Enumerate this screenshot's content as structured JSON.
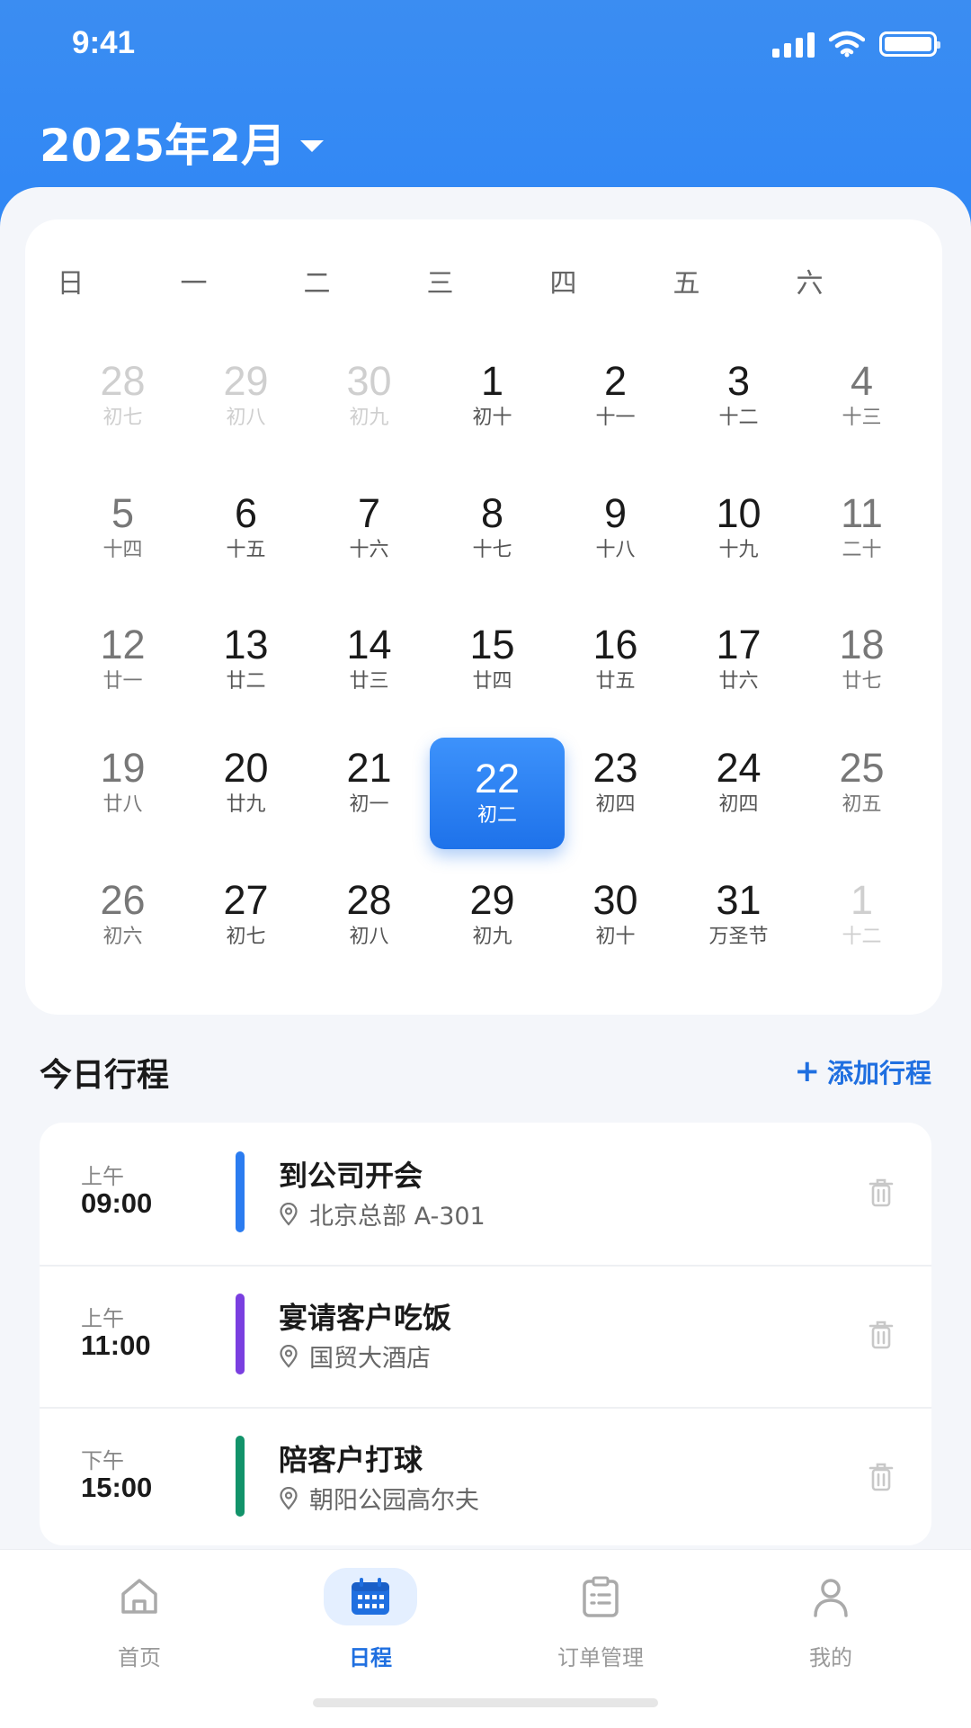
{
  "status_bar": {
    "time": "9:41"
  },
  "header": {
    "month_title": "2025年2月"
  },
  "calendar": {
    "weekdays": [
      "日",
      "一",
      "二",
      "三",
      "四",
      "五",
      "六"
    ],
    "weeks": [
      [
        {
          "n": "28",
          "s": "初七",
          "t": "other"
        },
        {
          "n": "29",
          "s": "初八",
          "t": "other"
        },
        {
          "n": "30",
          "s": "初九",
          "t": "other"
        },
        {
          "n": "1",
          "s": "初十",
          "t": "normal"
        },
        {
          "n": "2",
          "s": "十一",
          "t": "normal"
        },
        {
          "n": "3",
          "s": "十二",
          "t": "normal"
        },
        {
          "n": "4",
          "s": "十三",
          "t": "weekend"
        }
      ],
      [
        {
          "n": "5",
          "s": "十四",
          "t": "weekend"
        },
        {
          "n": "6",
          "s": "十五",
          "t": "normal"
        },
        {
          "n": "7",
          "s": "十六",
          "t": "normal"
        },
        {
          "n": "8",
          "s": "十七",
          "t": "normal"
        },
        {
          "n": "9",
          "s": "十八",
          "t": "normal"
        },
        {
          "n": "10",
          "s": "十九",
          "t": "normal"
        },
        {
          "n": "11",
          "s": "二十",
          "t": "weekend"
        }
      ],
      [
        {
          "n": "12",
          "s": "廿一",
          "t": "weekend"
        },
        {
          "n": "13",
          "s": "廿二",
          "t": "normal"
        },
        {
          "n": "14",
          "s": "廿三",
          "t": "normal"
        },
        {
          "n": "15",
          "s": "廿四",
          "t": "normal"
        },
        {
          "n": "16",
          "s": "廿五",
          "t": "normal"
        },
        {
          "n": "17",
          "s": "廿六",
          "t": "normal"
        },
        {
          "n": "18",
          "s": "廿七",
          "t": "weekend"
        }
      ],
      [
        {
          "n": "19",
          "s": "廿八",
          "t": "weekend"
        },
        {
          "n": "20",
          "s": "廿九",
          "t": "normal"
        },
        {
          "n": "21",
          "s": "初一",
          "t": "normal"
        },
        {
          "n": "22",
          "s": "初二",
          "t": "selected"
        },
        {
          "n": "23",
          "s": "初四",
          "t": "normal"
        },
        {
          "n": "24",
          "s": "初四",
          "t": "normal"
        },
        {
          "n": "25",
          "s": "初五",
          "t": "weekend"
        }
      ],
      [
        {
          "n": "26",
          "s": "初六",
          "t": "weekend"
        },
        {
          "n": "27",
          "s": "初七",
          "t": "normal"
        },
        {
          "n": "28",
          "s": "初八",
          "t": "normal"
        },
        {
          "n": "29",
          "s": "初九",
          "t": "normal"
        },
        {
          "n": "30",
          "s": "初十",
          "t": "normal"
        },
        {
          "n": "31",
          "s": "万圣节",
          "t": "normal"
        },
        {
          "n": "1",
          "s": "十二",
          "t": "other"
        }
      ]
    ]
  },
  "schedule": {
    "title": "今日行程",
    "add_label": "添加行程",
    "add_plus": "+",
    "events": [
      {
        "period": "上午",
        "time": "09:00",
        "title": "到公司开会",
        "location": "北京总部 A-301",
        "color": "#2b7cf0"
      },
      {
        "period": "上午",
        "time": "11:00",
        "title": "宴请客户吃饭",
        "location": "国贸大酒店",
        "color": "#7a3fe0"
      },
      {
        "period": "下午",
        "time": "15:00",
        "title": "陪客户打球",
        "location": "朝阳公园高尔夫",
        "color": "#12936a"
      }
    ]
  },
  "tabbar": {
    "items": [
      {
        "label": "首页",
        "icon": "home-icon",
        "active": false
      },
      {
        "label": "日程",
        "icon": "calendar-icon",
        "active": true
      },
      {
        "label": "订单管理",
        "icon": "clipboard-icon",
        "active": false
      },
      {
        "label": "我的",
        "icon": "user-icon",
        "active": false
      }
    ]
  },
  "colors": {
    "accent": "#1f6fe0",
    "header": "#3b8df2"
  }
}
